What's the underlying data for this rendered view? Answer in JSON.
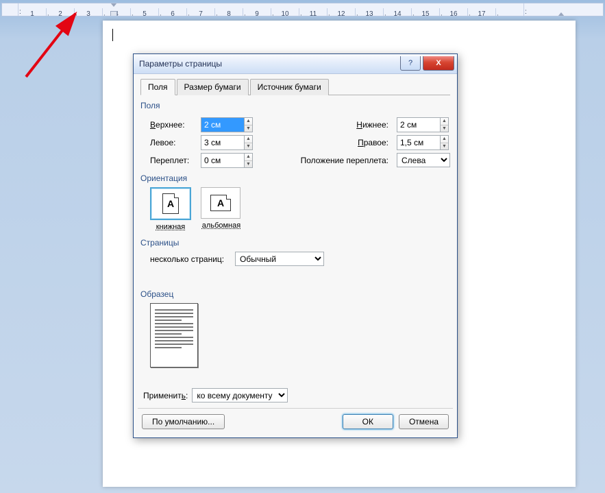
{
  "ruler": {
    "marks": [
      "3",
      "2",
      "1",
      "",
      "1",
      "2",
      "3",
      "4",
      "5",
      "6",
      "7",
      "8",
      "9",
      "10",
      "11",
      "12",
      "13",
      "14",
      "15",
      "16",
      "17",
      ""
    ]
  },
  "dialog": {
    "title": "Параметры страницы",
    "help_char": "?",
    "close_char": "X",
    "tabs": [
      "Поля",
      "Размер бумаги",
      "Источник бумаги"
    ],
    "active_tab": 0,
    "margins": {
      "legend": "Поля",
      "top": {
        "label": "Верхнее:",
        "value": "2 см"
      },
      "bottom": {
        "label": "Нижнее:",
        "value": "2 см"
      },
      "left": {
        "label": "Левое:",
        "value": "3 см"
      },
      "right": {
        "label": "Правое:",
        "value": "1,5 см"
      },
      "gutter": {
        "label": "Переплет:",
        "value": "0 см"
      },
      "gutter_pos": {
        "label": "Положение переплета:",
        "value": "Слева"
      }
    },
    "orientation": {
      "legend": "Ориентация",
      "portrait": "книжная",
      "landscape": "альбомная",
      "glyph": "A"
    },
    "pages": {
      "legend": "Страницы",
      "label": "несколько страниц:",
      "value": "Обычный"
    },
    "preview": {
      "legend": "Образец"
    },
    "apply": {
      "label": "Применить:",
      "value": "ко всему документу"
    },
    "buttons": {
      "defaults": "По умолчанию...",
      "ok": "ОК",
      "cancel": "Отмена"
    }
  }
}
